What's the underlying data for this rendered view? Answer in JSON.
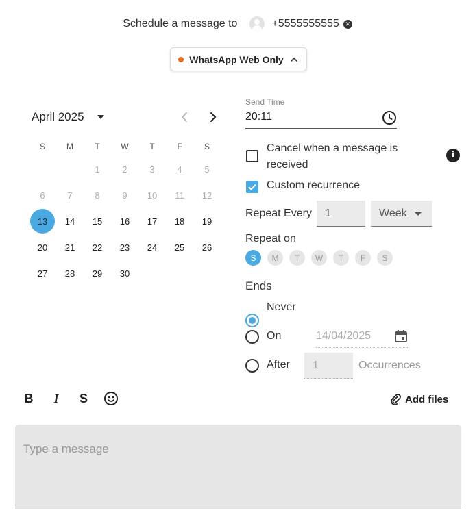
{
  "header": {
    "label": "Schedule a message to",
    "recipient": "+5555555555",
    "avatar_icon": "user-avatar-icon",
    "remove_icon": "close-circle-icon"
  },
  "channel": {
    "label": "WhatsApp Web Only",
    "status_color": "#e8681c",
    "icon": "chevron-up-icon"
  },
  "calendar": {
    "month_label": "April 2025",
    "weekdays": [
      "S",
      "M",
      "T",
      "W",
      "T",
      "F",
      "S"
    ],
    "weeks": [
      [
        {
          "d": ""
        },
        {
          "d": ""
        },
        {
          "d": "1",
          "m": true
        },
        {
          "d": "2",
          "m": true
        },
        {
          "d": "3",
          "m": true
        },
        {
          "d": "4",
          "m": true
        },
        {
          "d": "5",
          "m": true
        }
      ],
      [
        {
          "d": "6",
          "m": true
        },
        {
          "d": "7",
          "m": true
        },
        {
          "d": "8",
          "m": true
        },
        {
          "d": "9",
          "m": true
        },
        {
          "d": "10",
          "m": true
        },
        {
          "d": "11",
          "m": true
        },
        {
          "d": "12",
          "m": true
        }
      ],
      [
        {
          "d": "13",
          "s": true
        },
        {
          "d": "14"
        },
        {
          "d": "15"
        },
        {
          "d": "16"
        },
        {
          "d": "17"
        },
        {
          "d": "18"
        },
        {
          "d": "19"
        }
      ],
      [
        {
          "d": "20"
        },
        {
          "d": "21"
        },
        {
          "d": "22"
        },
        {
          "d": "23"
        },
        {
          "d": "24"
        },
        {
          "d": "25"
        },
        {
          "d": "26"
        }
      ],
      [
        {
          "d": "27"
        },
        {
          "d": "28"
        },
        {
          "d": "29"
        },
        {
          "d": "30"
        },
        {
          "d": ""
        },
        {
          "d": ""
        },
        {
          "d": ""
        }
      ]
    ],
    "selected_day": "13",
    "accent": "#4aa9e0"
  },
  "schedule": {
    "send_time_label": "Send Time",
    "send_time_value": "20:11",
    "cancel_label": "Cancel when a message is received",
    "cancel_checked": false,
    "custom_recurrence_label": "Custom recurrence",
    "custom_recurrence_checked": true,
    "repeat_every_label": "Repeat Every",
    "repeat_every_value": "1",
    "repeat_unit": "Week",
    "repeat_on_label": "Repeat on",
    "repeat_days": [
      "S",
      "M",
      "T",
      "W",
      "T",
      "F",
      "S"
    ],
    "repeat_days_active": [
      true,
      false,
      false,
      false,
      false,
      false,
      false
    ],
    "ends_label": "Ends",
    "never_label": "Never",
    "on_label": "On",
    "on_date": "14/04/2025",
    "after_label": "After",
    "after_value": "1",
    "occurrences_label": "Occurrences",
    "ends_selected": "never"
  },
  "toolbar": {
    "bold": "B",
    "italic": "I",
    "strike": "S",
    "emoji_icon": "emoji-smile-icon",
    "add_files_label": "Add files",
    "attach_icon": "paperclip-icon"
  },
  "message": {
    "placeholder": "Type a message"
  }
}
